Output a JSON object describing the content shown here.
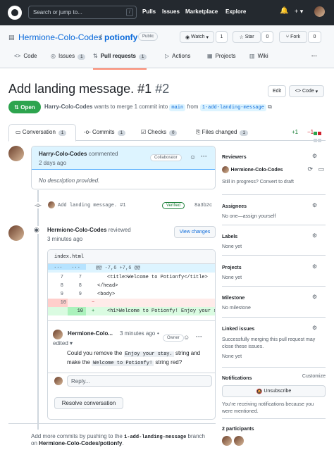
{
  "topnav": {
    "search": "Search or jump to...",
    "slash": "/",
    "pulls": "Pulls",
    "issues": "Issues",
    "marketplace": "Marketplace",
    "explore": "Explore"
  },
  "repo": {
    "owner": "Hermione-Colo-Codes",
    "slash": "/",
    "name": "potionfy",
    "visibility": "Public"
  },
  "actions": {
    "watch": "Watch",
    "watch_count": "1",
    "star": "Star",
    "star_count": "0",
    "fork": "Fork",
    "fork_count": "0"
  },
  "tabs": [
    {
      "label": "Code"
    },
    {
      "label": "Issues",
      "count": "1"
    },
    {
      "label": "Pull requests",
      "count": "1"
    },
    {
      "label": "Actions"
    },
    {
      "label": "Projects"
    },
    {
      "label": "Wiki"
    }
  ],
  "pr": {
    "title": "Add landing message.",
    "number": "#1",
    "number2": "#2",
    "edit": "Edit",
    "code": "Code",
    "state": "Open",
    "author": "Harry-Colo-Codes",
    "merge_text": "wants to merge 1 commit into",
    "base": "main",
    "from": "from",
    "head": "1-add-landing-message"
  },
  "pr_tabs": {
    "conversation": "Conversation",
    "conversation_count": "1",
    "commits": "Commits",
    "commits_count": "1",
    "checks": "Checks",
    "checks_count": "0",
    "files": "Files changed",
    "files_count": "1",
    "plus": "+1",
    "minus": "−1"
  },
  "comment": {
    "author": "Harry-Colo-Codes",
    "verb": "commented",
    "time": "2 days ago",
    "role": "Collaborator",
    "body": "No description provided."
  },
  "commit": {
    "message": "Add landing message. #1",
    "status": "Verified",
    "sha": "8a3b2c"
  },
  "review": {
    "author": "Hermione-Colo-Codes",
    "verb": "reviewed",
    "time": "3 minutes ago",
    "view_changes": "View changes",
    "file": "index.html",
    "hunk": "@@ -7,6 +7,6 @@",
    "lines": [
      {
        "a": "7",
        "b": "7",
        "sign": "",
        "code": "<title>Welcome to Potionfy</title>"
      },
      {
        "a": "8",
        "b": "8",
        "sign": "",
        "code": "</head>"
      },
      {
        "a": "9",
        "b": "9",
        "sign": "",
        "code": "<body>"
      },
      {
        "a": "10",
        "b": "",
        "sign": "−",
        "code": ""
      },
      {
        "a": "",
        "b": "10",
        "sign": "+",
        "code": "<h1>Welcome to Potionfy! Enjoy your s"
      }
    ],
    "inner_author": "Hermione-Colo...",
    "inner_time": "3 minutes ago",
    "inner_edited": "edited",
    "inner_role": "Owner",
    "inner_body_1": "Could you remove the",
    "inner_code_1": "Enjoy your stay.",
    "inner_body_2": "string and make the",
    "inner_code_2": "Welcome to Potionfy!",
    "inner_body_3": "string red?",
    "reply": "Reply...",
    "resolve": "Resolve conversation"
  },
  "sidebar": {
    "reviewers": "Reviewers",
    "reviewer": "Hermione-Colo-Codes",
    "reviewer_note": "Still in progress? Convert to draft",
    "assignees": "Assignees",
    "assignees_none": "No one—assign yourself",
    "labels": "Labels",
    "labels_none": "None yet",
    "projects": "Projects",
    "projects_none": "None yet",
    "milestone": "Milestone",
    "milestone_none": "No milestone",
    "linked": "Linked issues",
    "linked_note": "Successfully merging this pull request may close these issues.",
    "linked_none": "None yet",
    "notifications": "Notifications",
    "customize": "Customize",
    "unsubscribe": "Unsubscribe",
    "notif_note": "You’re receiving notifications because you were mentioned.",
    "participants": "2 participants"
  },
  "bottom": {
    "text_1": "Add more commits by pushing to the",
    "branch": "1-add-landing-message",
    "text_2": "branch",
    "text_3": "on",
    "repo": "Hermione-Colo-Codes/potionfy",
    "dot": "."
  }
}
